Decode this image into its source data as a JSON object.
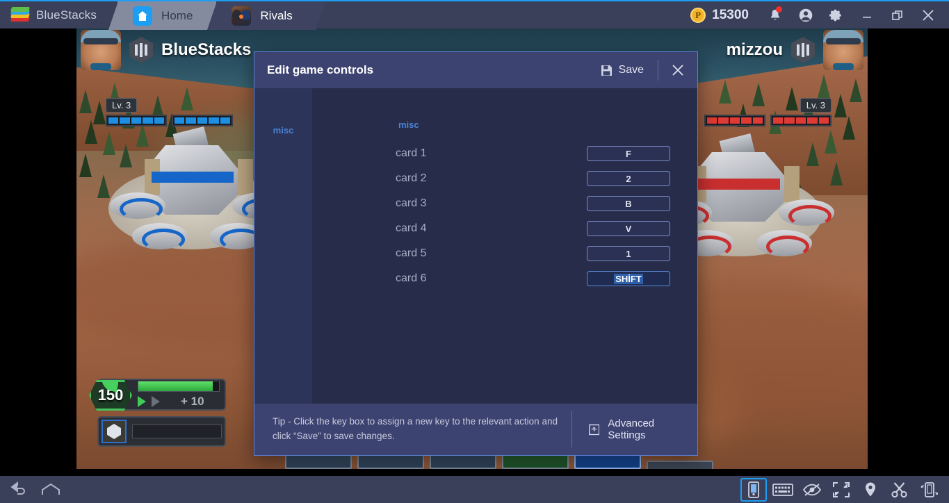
{
  "titlebar": {
    "brand": "BlueStacks",
    "brand_logo_icon": "bluestacks-logo-icon",
    "tabs": [
      {
        "label": "Home",
        "icon": "home-icon",
        "active": false
      },
      {
        "label": "Rivals",
        "icon": "rivals-app-icon",
        "active": true
      }
    ],
    "coins": {
      "icon": "points-coin-icon",
      "amount": "15300"
    },
    "buttons": [
      {
        "name": "notifications-button",
        "icon": "bell-icon",
        "badge": true
      },
      {
        "name": "account-button",
        "icon": "user-avatar-icon"
      },
      {
        "name": "settings-button",
        "icon": "gear-icon"
      },
      {
        "name": "minimize-button",
        "icon": "minimize-icon"
      },
      {
        "name": "restore-button",
        "icon": "restore-icon"
      },
      {
        "name": "close-button",
        "icon": "close-icon"
      }
    ]
  },
  "game": {
    "player_left": {
      "name": "BlueStacks",
      "level": "Lv. 3",
      "team_color": "#1e8fe0"
    },
    "player_right": {
      "name": "mizzou",
      "level": "Lv. 3",
      "team_color": "#e03a34"
    },
    "resource": {
      "value": "150",
      "gain": "+ 10"
    }
  },
  "dialog": {
    "title": "Edit game controls",
    "save_label": "Save",
    "save_icon": "save-disk-icon",
    "close_icon": "close-icon",
    "sidebar": {
      "items": [
        {
          "label": "misc",
          "active": true
        }
      ]
    },
    "group_title": "misc",
    "bindings": [
      {
        "action": "card 1",
        "key": "F",
        "focused": false
      },
      {
        "action": "card 2",
        "key": "2",
        "focused": false
      },
      {
        "action": "card 3",
        "key": "B",
        "focused": false
      },
      {
        "action": "card 4",
        "key": "V",
        "focused": false
      },
      {
        "action": "card 5",
        "key": "1",
        "focused": false
      },
      {
        "action": "card 6",
        "key": "SHİFT",
        "focused": true
      }
    ],
    "footer": {
      "tip": "Tip - Click the key box to assign a new key to the relevant action and click “Save” to save changes.",
      "advanced_label": "Advanced Settings",
      "advanced_icon": "advanced-settings-icon"
    }
  },
  "bottombar": {
    "left": [
      {
        "name": "back-button",
        "icon": "back-arrow-icon"
      },
      {
        "name": "home-button",
        "icon": "home-pentagon-icon"
      }
    ],
    "right": [
      {
        "name": "tilt-control-button",
        "icon": "tilt-phone-icon",
        "selected": true
      },
      {
        "name": "keymapping-button",
        "icon": "keyboard-icon",
        "selected": false
      },
      {
        "name": "eye-off-button",
        "icon": "eye-off-icon",
        "selected": false
      },
      {
        "name": "fullscreen-button",
        "icon": "fullscreen-arrows-icon",
        "selected": false
      },
      {
        "name": "location-button",
        "icon": "location-pin-icon",
        "selected": false
      },
      {
        "name": "screenshot-button",
        "icon": "scissors-icon",
        "selected": false
      },
      {
        "name": "shake-button",
        "icon": "shake-phone-icon",
        "selected": false
      }
    ]
  }
}
